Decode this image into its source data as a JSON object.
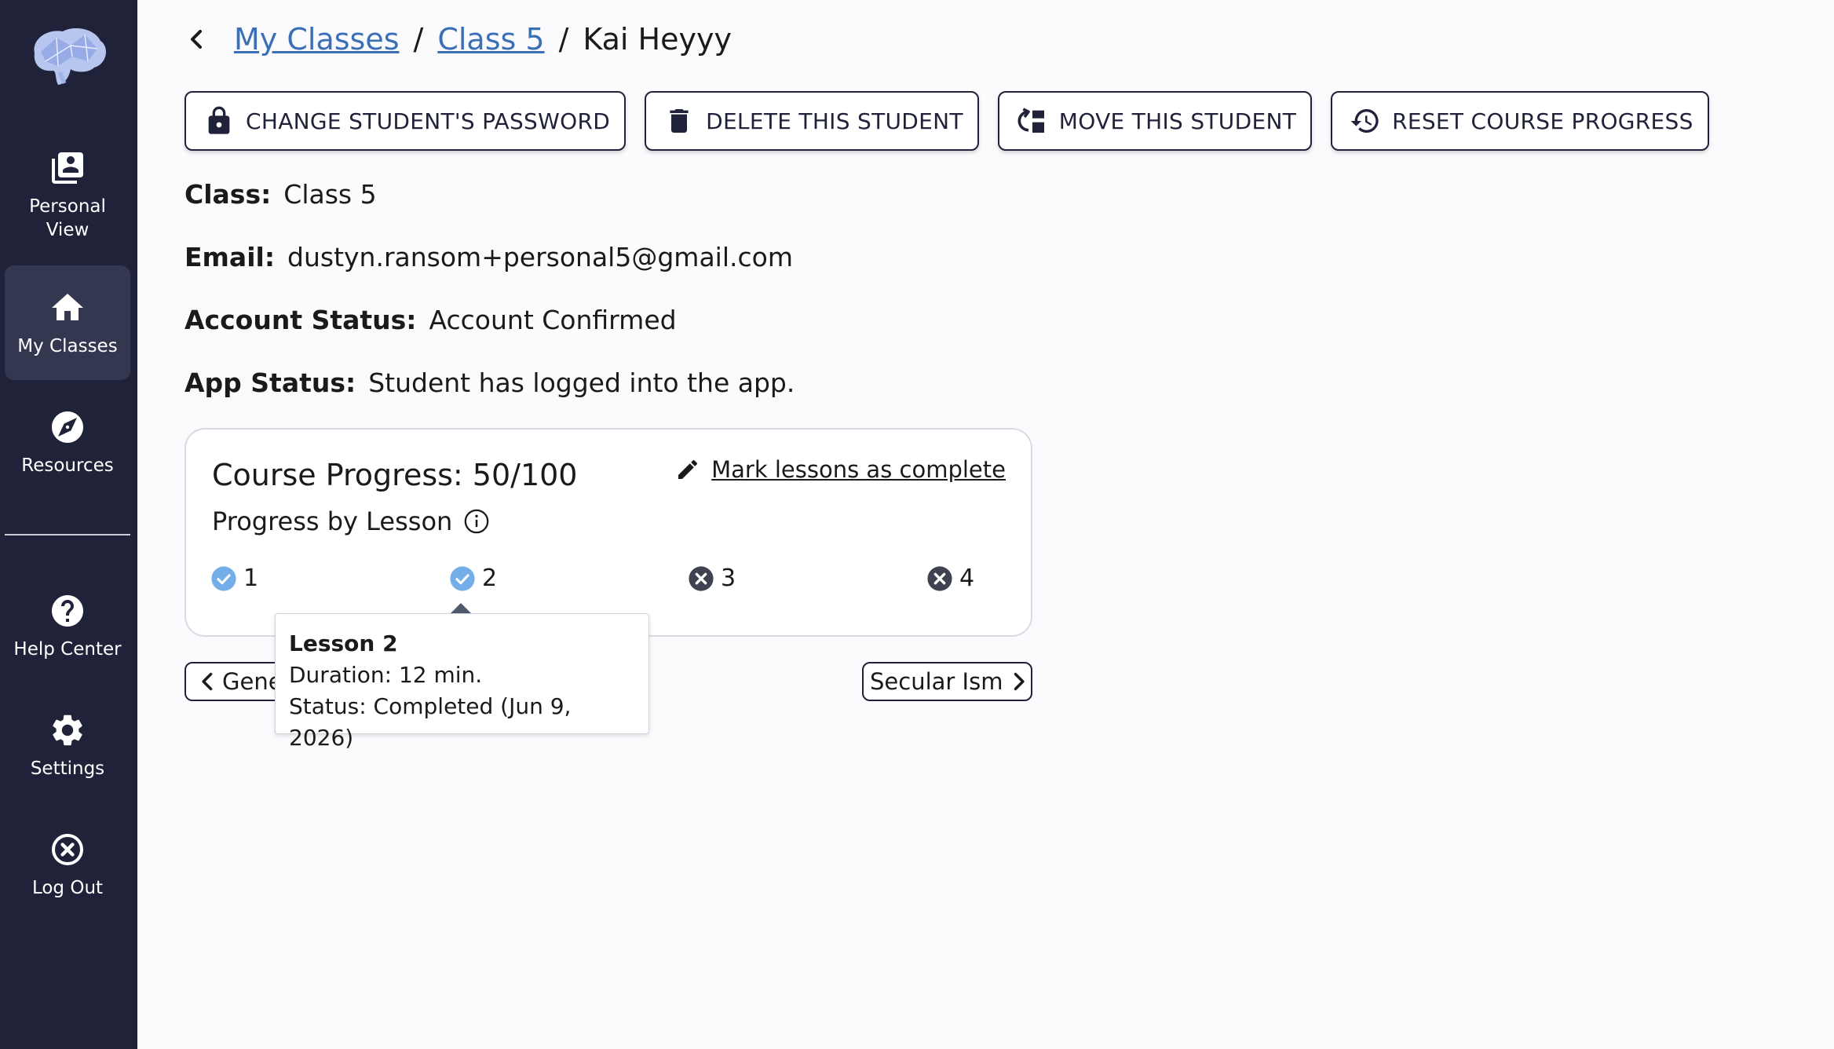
{
  "sidebar": {
    "items": [
      {
        "label": "Personal View",
        "icon": "person-list-icon"
      },
      {
        "label": "My Classes",
        "icon": "home-icon",
        "active": true
      },
      {
        "label": "Resources",
        "icon": "compass-icon"
      },
      {
        "label": "Help Center",
        "icon": "help-icon"
      },
      {
        "label": "Settings",
        "icon": "gear-icon"
      },
      {
        "label": "Log Out",
        "icon": "close-circle-icon"
      }
    ]
  },
  "breadcrumb": {
    "items": [
      "My Classes",
      "Class 5"
    ],
    "separator": "/",
    "current": "Kai Heyyy"
  },
  "actions": [
    {
      "label": "CHANGE STUDENT'S PASSWORD",
      "icon": "lock-icon"
    },
    {
      "label": "DELETE THIS STUDENT",
      "icon": "trash-icon"
    },
    {
      "label": "MOVE THIS STUDENT",
      "icon": "move-icon"
    },
    {
      "label": "RESET COURSE PROGRESS",
      "icon": "history-icon"
    }
  ],
  "student": {
    "class_label": "Class:",
    "class_value": "Class 5",
    "email_label": "Email:",
    "email_value": "dustyn.ransom+personal5@gmail.com",
    "account_label": "Account Status:",
    "account_value": "Account Confirmed",
    "app_label": "App Status:",
    "app_value": "Student has logged into the app."
  },
  "progress": {
    "title": "Course Progress: 50/100",
    "subtitle": "Progress by Lesson",
    "mark_link": "Mark lessons as complete",
    "lessons": [
      {
        "number": "1",
        "completed": true
      },
      {
        "number": "2",
        "completed": true
      },
      {
        "number": "3",
        "completed": false
      },
      {
        "number": "4",
        "completed": false
      }
    ]
  },
  "pager": {
    "prev_label": "Gene",
    "next_label": "Secular Ism"
  },
  "tooltip": {
    "title": "Lesson 2",
    "duration": "Duration: 12 min.",
    "status": "Status: Completed (Jun 9, 2026)"
  },
  "colors": {
    "sidebar_bg": "#1f2238",
    "link": "#3b6fb6",
    "check_blue": "#74aee8",
    "x_gray": "#3f4250"
  }
}
